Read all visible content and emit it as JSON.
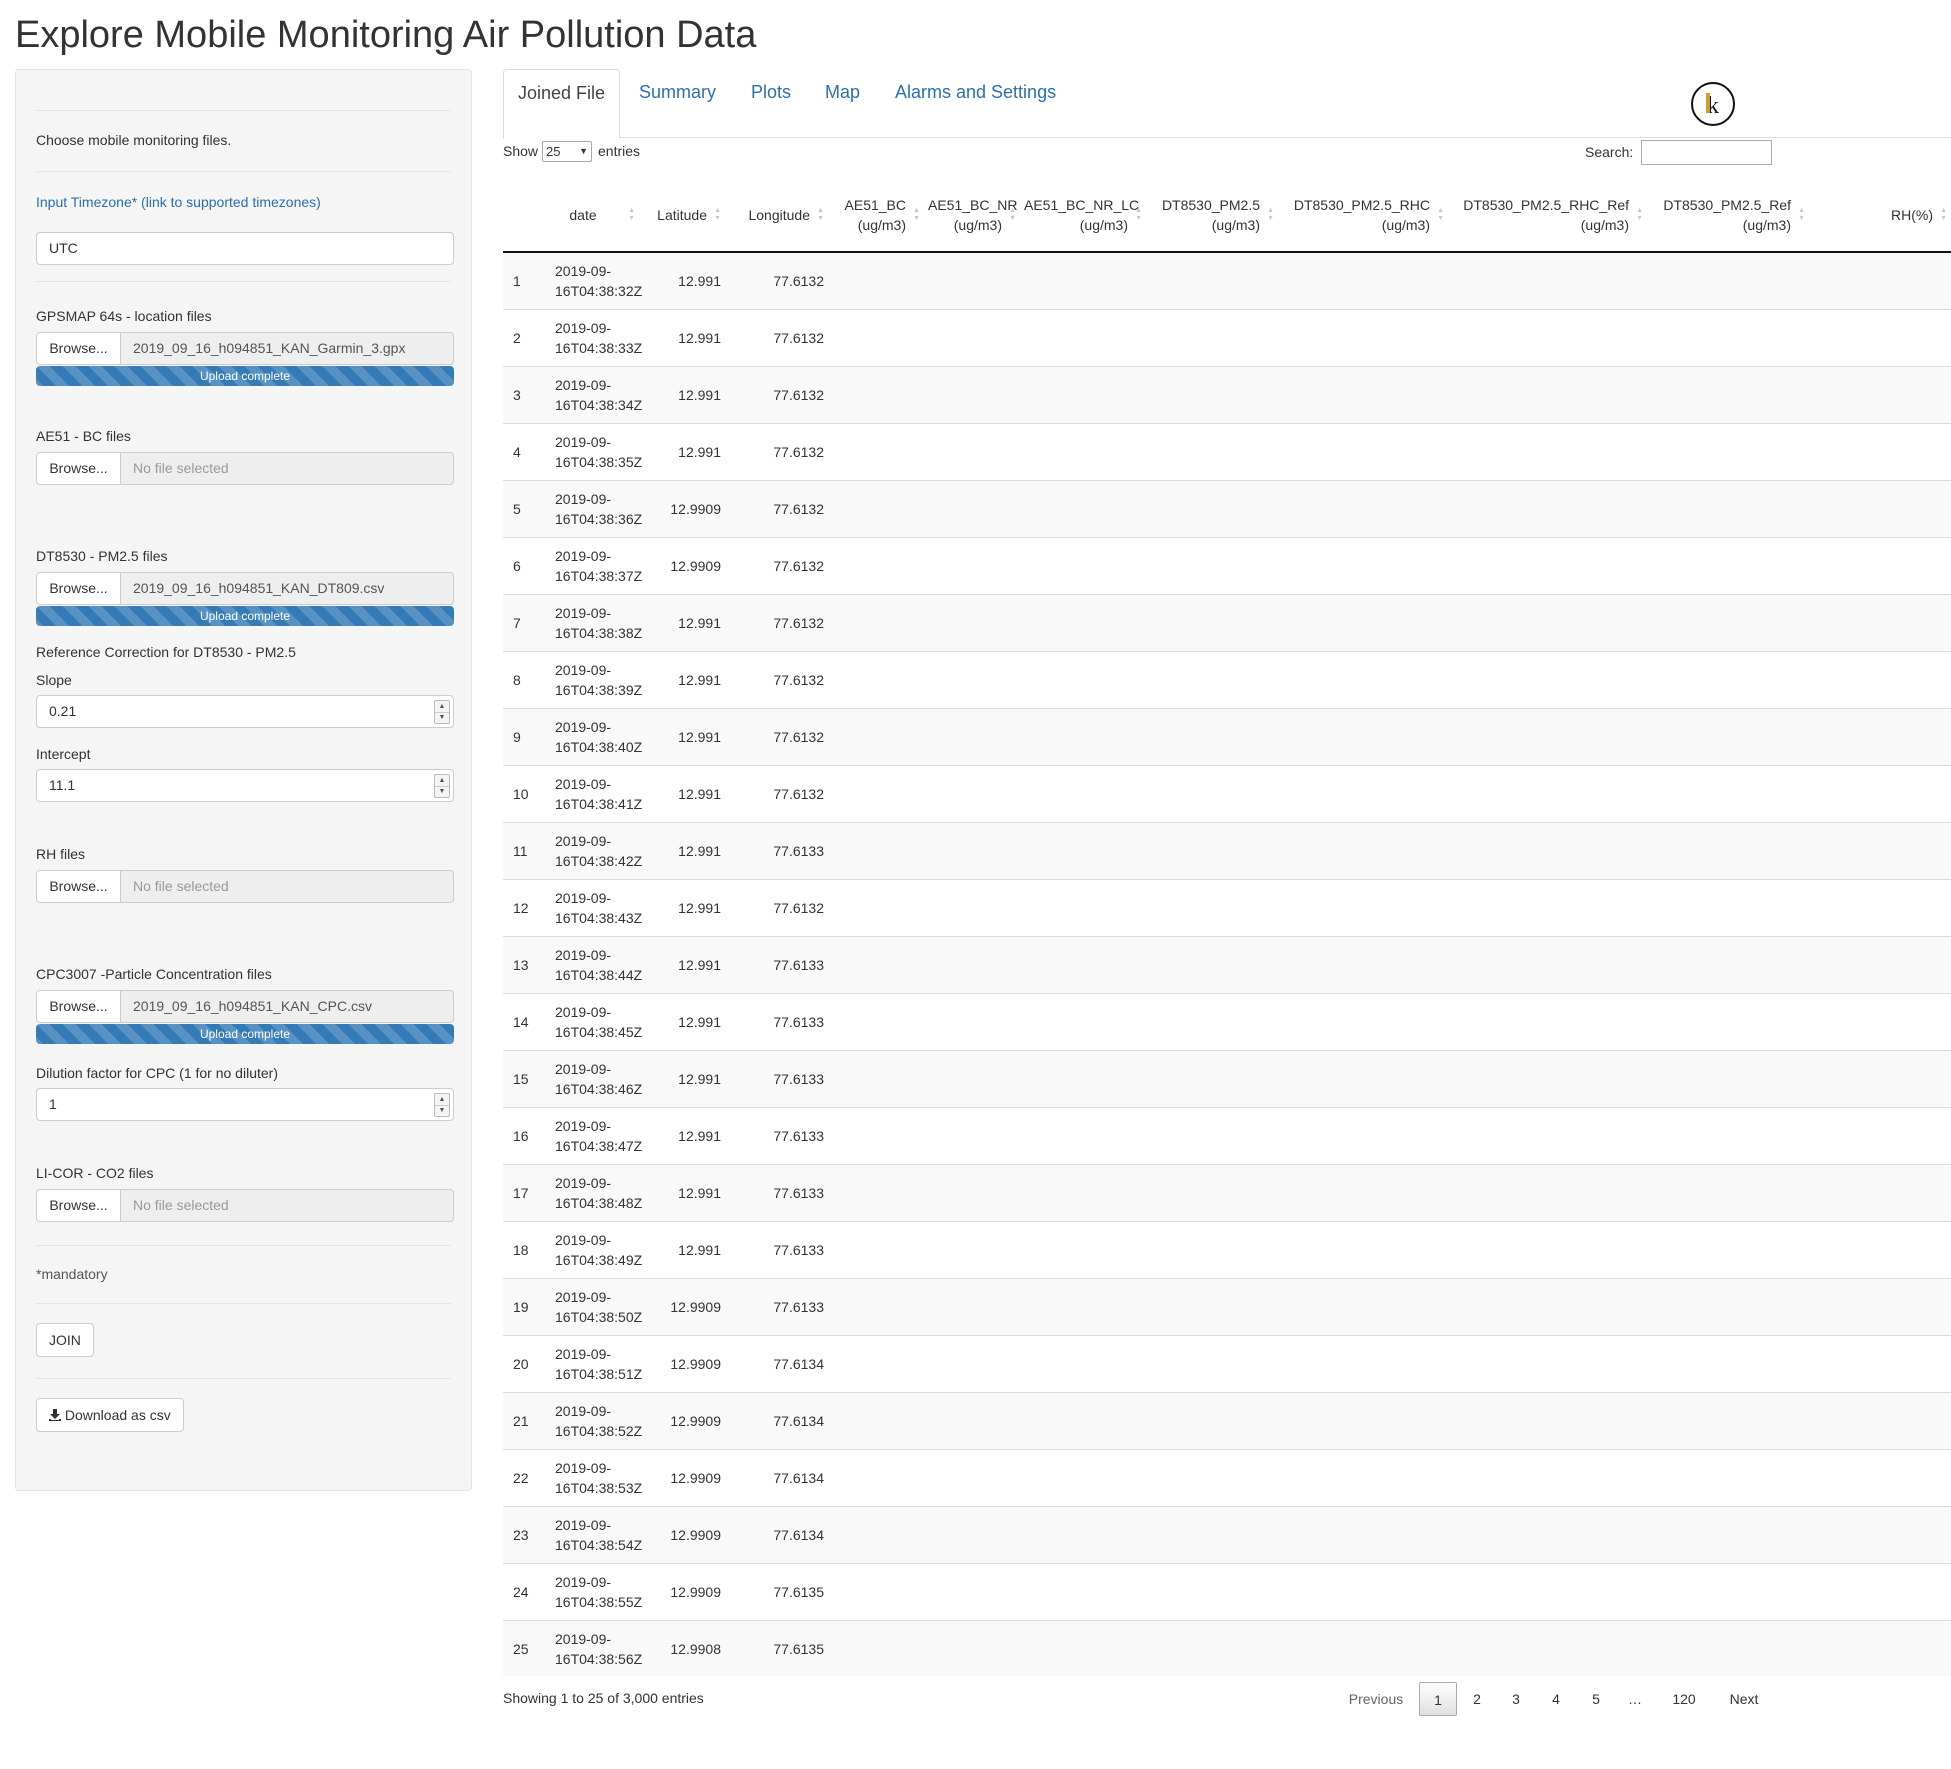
{
  "app_title": "Explore Mobile Monitoring Air Pollution Data",
  "sidebar": {
    "choose_files_label": "Choose mobile monitoring files.",
    "timezone_link": "Input Timezone* (link to supported timezones)",
    "timezone_value": "UTC",
    "gps": {
      "label": "GPSMAP 64s - location files",
      "browse": "Browse...",
      "file": "2019_09_16_h094851_KAN_Garmin_3.gpx",
      "progress": "Upload complete"
    },
    "ae51": {
      "label": "AE51 - BC files",
      "browse": "Browse...",
      "file": "No file selected"
    },
    "dt8530": {
      "label": "DT8530 - PM2.5 files",
      "browse": "Browse...",
      "file": "2019_09_16_h094851_KAN_DT809.csv",
      "progress": "Upload complete"
    },
    "ref_correction_label": "Reference Correction for DT8530 - PM2.5",
    "slope_label": "Slope",
    "slope_value": "0.21",
    "intercept_label": "Intercept",
    "intercept_value": "11.1",
    "rh": {
      "label": "RH files",
      "browse": "Browse...",
      "file": "No file selected"
    },
    "cpc": {
      "label": "CPC3007 -Particle Concentration files",
      "browse": "Browse...",
      "file": "2019_09_16_h094851_KAN_CPC.csv",
      "progress": "Upload complete"
    },
    "dilution_label": "Dilution factor for CPC (1 for no diluter)",
    "dilution_value": "1",
    "licor": {
      "label": "LI-COR - CO2 files",
      "browse": "Browse...",
      "file": "No file selected"
    },
    "mandatory_note": "*mandatory",
    "join_button": "JOIN",
    "download_button": "Download as csv",
    "download_icon": "download-icon"
  },
  "tabs": [
    {
      "label": "Joined File",
      "active": true
    },
    {
      "label": "Summary",
      "active": false
    },
    {
      "label": "Plots",
      "active": false
    },
    {
      "label": "Map",
      "active": false
    },
    {
      "label": "Alarms and Settings",
      "active": false
    }
  ],
  "logo_icon": "ilk-logo-icon",
  "table_controls": {
    "show_label": "Show",
    "length_value": "25",
    "entries_label": "entries",
    "search_label": "Search:",
    "search_value": ""
  },
  "table": {
    "columns": [
      {
        "line1": "",
        "line2": ""
      },
      {
        "line1": "date",
        "line2": ""
      },
      {
        "line1": "Latitude",
        "line2": ""
      },
      {
        "line1": "Longitude",
        "line2": ""
      },
      {
        "line1": "AE51_BC",
        "line2": "(ug/m3)"
      },
      {
        "line1": "AE51_BC_NR",
        "line2": "(ug/m3)"
      },
      {
        "line1": "AE51_BC_NR_LC",
        "line2": "(ug/m3)"
      },
      {
        "line1": "DT8530_PM2.5",
        "line2": "(ug/m3)"
      },
      {
        "line1": "DT8530_PM2.5_RHC",
        "line2": "(ug/m3)"
      },
      {
        "line1": "DT8530_PM2.5_RHC_Ref",
        "line2": "(ug/m3)"
      },
      {
        "line1": "DT8530_PM2.5_Ref",
        "line2": "(ug/m3)"
      },
      {
        "line1": "RH(%)",
        "line2": ""
      }
    ],
    "rows": [
      {
        "idx": "1",
        "date1": "2019-09-",
        "date2": "16T04:38:32Z",
        "lat": "12.991",
        "lon": "77.6132"
      },
      {
        "idx": "2",
        "date1": "2019-09-",
        "date2": "16T04:38:33Z",
        "lat": "12.991",
        "lon": "77.6132"
      },
      {
        "idx": "3",
        "date1": "2019-09-",
        "date2": "16T04:38:34Z",
        "lat": "12.991",
        "lon": "77.6132"
      },
      {
        "idx": "4",
        "date1": "2019-09-",
        "date2": "16T04:38:35Z",
        "lat": "12.991",
        "lon": "77.6132"
      },
      {
        "idx": "5",
        "date1": "2019-09-",
        "date2": "16T04:38:36Z",
        "lat": "12.9909",
        "lon": "77.6132"
      },
      {
        "idx": "6",
        "date1": "2019-09-",
        "date2": "16T04:38:37Z",
        "lat": "12.9909",
        "lon": "77.6132"
      },
      {
        "idx": "7",
        "date1": "2019-09-",
        "date2": "16T04:38:38Z",
        "lat": "12.991",
        "lon": "77.6132"
      },
      {
        "idx": "8",
        "date1": "2019-09-",
        "date2": "16T04:38:39Z",
        "lat": "12.991",
        "lon": "77.6132"
      },
      {
        "idx": "9",
        "date1": "2019-09-",
        "date2": "16T04:38:40Z",
        "lat": "12.991",
        "lon": "77.6132"
      },
      {
        "idx": "10",
        "date1": "2019-09-",
        "date2": "16T04:38:41Z",
        "lat": "12.991",
        "lon": "77.6132"
      },
      {
        "idx": "11",
        "date1": "2019-09-",
        "date2": "16T04:38:42Z",
        "lat": "12.991",
        "lon": "77.6133"
      },
      {
        "idx": "12",
        "date1": "2019-09-",
        "date2": "16T04:38:43Z",
        "lat": "12.991",
        "lon": "77.6132"
      },
      {
        "idx": "13",
        "date1": "2019-09-",
        "date2": "16T04:38:44Z",
        "lat": "12.991",
        "lon": "77.6133"
      },
      {
        "idx": "14",
        "date1": "2019-09-",
        "date2": "16T04:38:45Z",
        "lat": "12.991",
        "lon": "77.6133"
      },
      {
        "idx": "15",
        "date1": "2019-09-",
        "date2": "16T04:38:46Z",
        "lat": "12.991",
        "lon": "77.6133"
      },
      {
        "idx": "16",
        "date1": "2019-09-",
        "date2": "16T04:38:47Z",
        "lat": "12.991",
        "lon": "77.6133"
      },
      {
        "idx": "17",
        "date1": "2019-09-",
        "date2": "16T04:38:48Z",
        "lat": "12.991",
        "lon": "77.6133"
      },
      {
        "idx": "18",
        "date1": "2019-09-",
        "date2": "16T04:38:49Z",
        "lat": "12.991",
        "lon": "77.6133"
      },
      {
        "idx": "19",
        "date1": "2019-09-",
        "date2": "16T04:38:50Z",
        "lat": "12.9909",
        "lon": "77.6133"
      },
      {
        "idx": "20",
        "date1": "2019-09-",
        "date2": "16T04:38:51Z",
        "lat": "12.9909",
        "lon": "77.6134"
      },
      {
        "idx": "21",
        "date1": "2019-09-",
        "date2": "16T04:38:52Z",
        "lat": "12.9909",
        "lon": "77.6134"
      },
      {
        "idx": "22",
        "date1": "2019-09-",
        "date2": "16T04:38:53Z",
        "lat": "12.9909",
        "lon": "77.6134"
      },
      {
        "idx": "23",
        "date1": "2019-09-",
        "date2": "16T04:38:54Z",
        "lat": "12.9909",
        "lon": "77.6134"
      },
      {
        "idx": "24",
        "date1": "2019-09-",
        "date2": "16T04:38:55Z",
        "lat": "12.9909",
        "lon": "77.6135"
      },
      {
        "idx": "25",
        "date1": "2019-09-",
        "date2": "16T04:38:56Z",
        "lat": "12.9908",
        "lon": "77.6135"
      }
    ]
  },
  "pagination": {
    "info": "Showing 1 to 25 of 3,000 entries",
    "previous": "Previous",
    "pages": [
      "1",
      "2",
      "3",
      "4",
      "5",
      "…",
      "120"
    ],
    "current": "1",
    "next": "Next"
  }
}
